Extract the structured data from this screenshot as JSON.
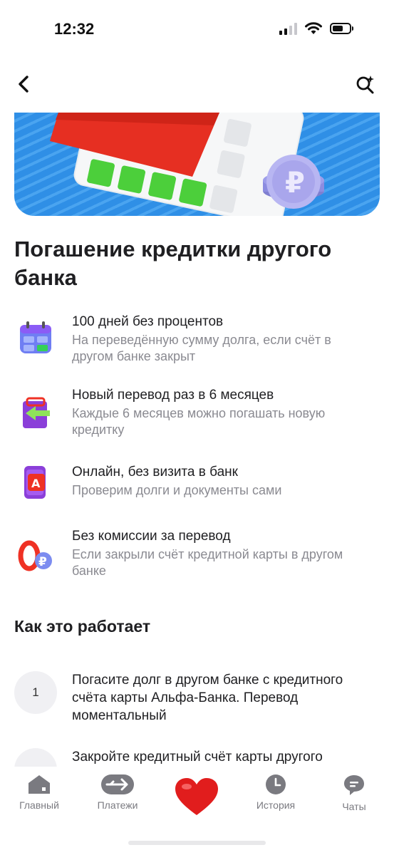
{
  "status_bar": {
    "time": "12:32",
    "signal_icon": "cellular-signal-icon",
    "wifi_icon": "wifi-icon",
    "battery_icon": "battery-icon"
  },
  "header": {
    "back_icon": "chevron-left-icon",
    "search_icon": "search-sparkle-icon"
  },
  "banner": {
    "image": "credit-card-and-ruble-coin-illustration"
  },
  "title": "Погашение кредитки другого банка",
  "features": [
    {
      "icon": "calendar-icon",
      "title": "100 дней без процентов",
      "description": "На переведённую сумму долга, если счёт в другом банке закрыт"
    },
    {
      "icon": "transfer-arrow-icon",
      "title": "Новый перевод раз в 6 месяцев",
      "description": "Каждые 6 месяцев можно погашать новую кредитку"
    },
    {
      "icon": "phone-alfa-icon",
      "title": "Онлайн, без визита в банк",
      "description": "Проверим долги и документы сами"
    },
    {
      "icon": "zero-ruble-icon",
      "title": "Без комиссии за перевод",
      "description": "Если закрыли счёт кредитной карты в другом банке"
    }
  ],
  "how_it_works": {
    "title": "Как это работает",
    "steps": [
      {
        "number": "1",
        "text": "Погасите долг в другом банке с кредитного счёта карты Альфа-Банка. Перевод моментальный"
      },
      {
        "number": "",
        "text": "Закройте кредитный счёт карты другого"
      }
    ]
  },
  "tab_bar": {
    "items": [
      {
        "label": "Главный",
        "icon": "home-icon"
      },
      {
        "label": "Платежи",
        "icon": "transfer-icon"
      },
      {
        "label": "",
        "icon": "heart-icon"
      },
      {
        "label": "История",
        "icon": "clock-icon"
      },
      {
        "label": "Чаты",
        "icon": "chat-icon"
      }
    ]
  },
  "colors": {
    "accent_red": "#ef3124",
    "banner_blue": "#2f8fe6",
    "secondary_text": "#8a8a91",
    "tab_gray": "#7a7a80"
  }
}
